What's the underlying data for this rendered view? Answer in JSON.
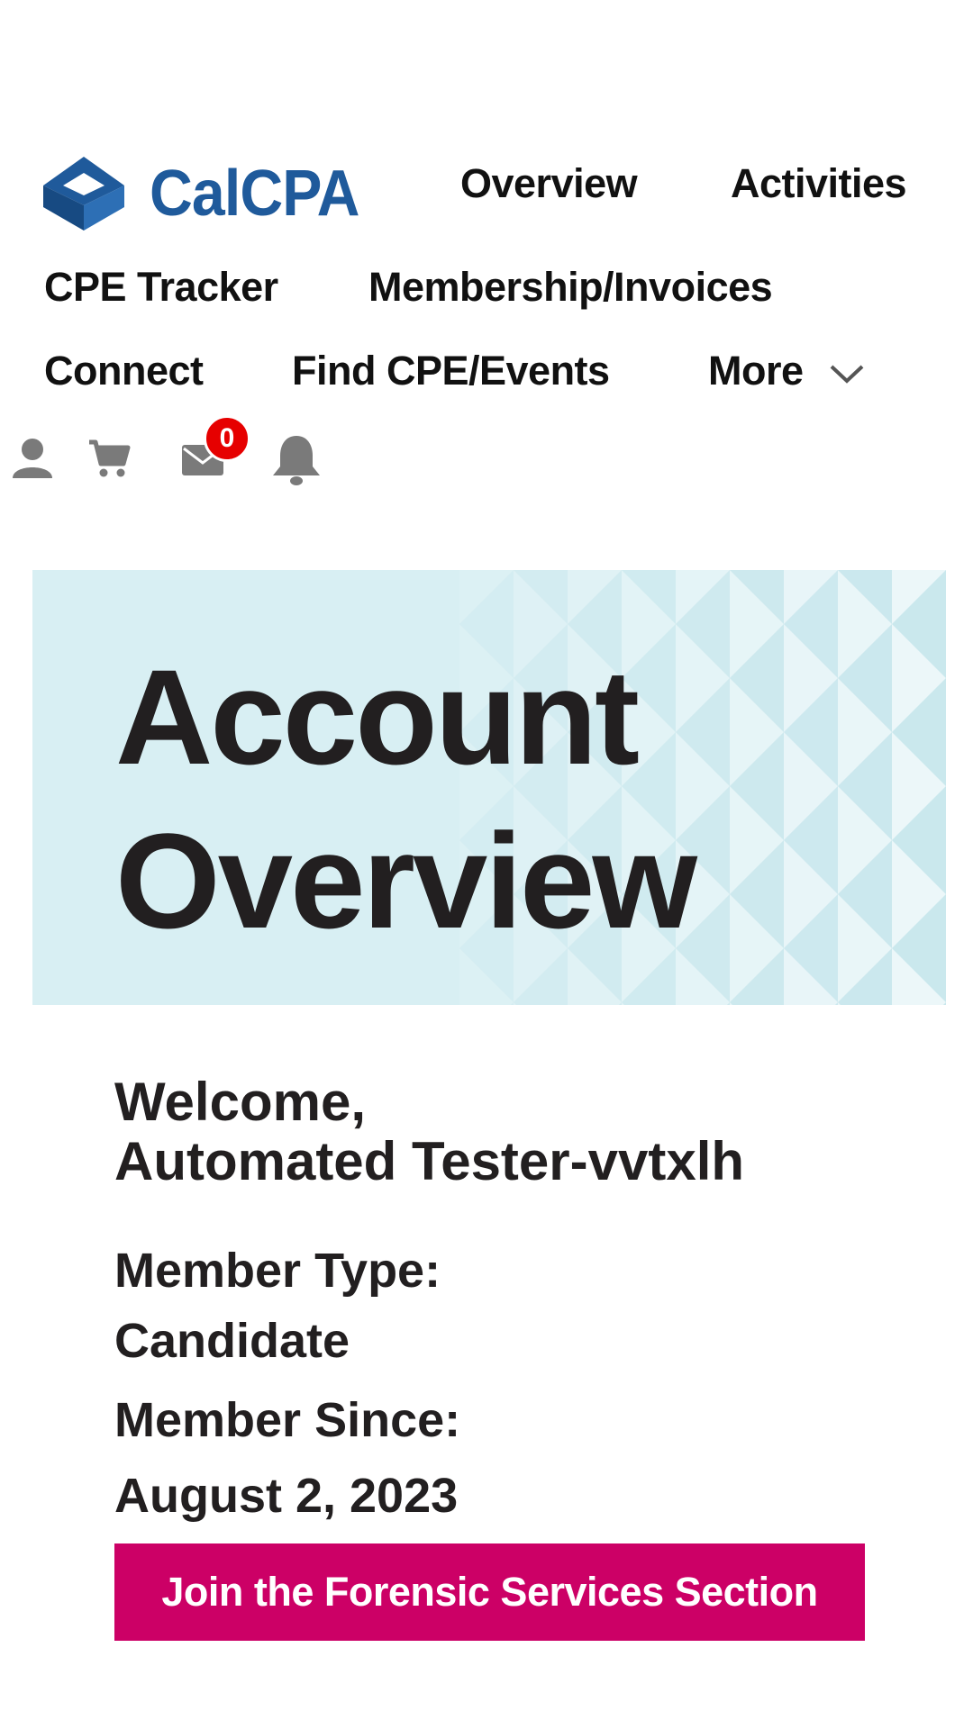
{
  "header": {
    "logo_text": "CalCPA",
    "nav": {
      "overview": "Overview",
      "activities": "Activities",
      "cpe_tracker": "CPE Tracker",
      "membership_invoices": "Membership/Invoices",
      "connect": "Connect",
      "find_cpe_events": "Find CPE/Events",
      "more": "More"
    },
    "icons": [
      "user-icon",
      "cart-icon",
      "mail-icon",
      "bell-icon"
    ],
    "message_count": "0"
  },
  "hero": {
    "title_line1": "Account",
    "title_line2": "Overview"
  },
  "account": {
    "welcome_line1": "Welcome,",
    "welcome_line2": "Automated Tester-vvtxlh",
    "member_type_label": "Member Type:",
    "member_type_value": "Candidate",
    "member_since_label": "Member Since:",
    "member_since_value": "August 2, 2023"
  },
  "cta": {
    "label": "Join the Forensic Services Section"
  },
  "colors": {
    "brand_blue": "#1f5a9b",
    "hero_bg": "#d8eff3",
    "cta_bg": "#cc0066",
    "badge_red": "#e60000",
    "icon_gray": "#7a7a7a"
  }
}
